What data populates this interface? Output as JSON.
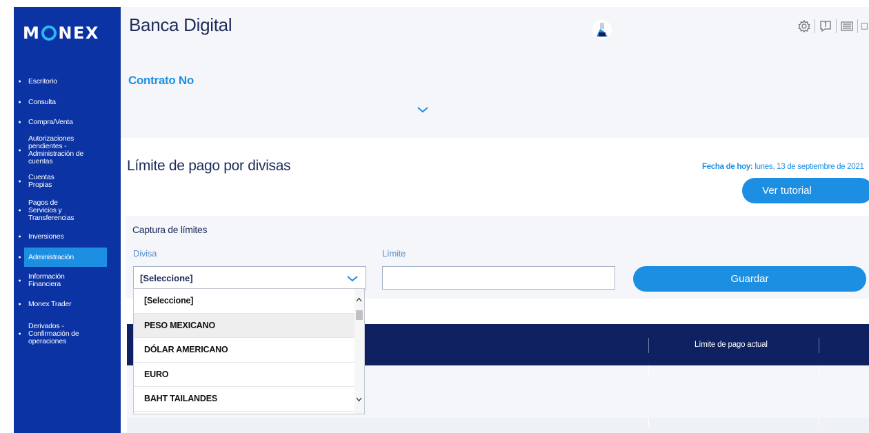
{
  "sidebar": {
    "logo_left": "M",
    "logo_right": "NEX",
    "items": [
      {
        "label": "Escritorio"
      },
      {
        "label": "Consulta"
      },
      {
        "label": "Compra/Venta"
      },
      {
        "label": "Autorizaciones pendientes - Administración de cuentas"
      },
      {
        "label": "Cuentas Propias"
      },
      {
        "label": "Pagos de Servicios y Transferencias"
      },
      {
        "label": "Inversiones"
      },
      {
        "label": "Administración",
        "active": true
      },
      {
        "label": "Información Financiera"
      },
      {
        "label": "Monex Trader"
      },
      {
        "label": "Derivados - Confirmación de operaciones"
      }
    ]
  },
  "header": {
    "title": "Banca Digital",
    "icons": [
      "settings-icon",
      "info-icon",
      "news-icon",
      "exit-icon"
    ]
  },
  "contract": {
    "title": "Contrato No"
  },
  "page": {
    "title": "Límite de pago por divisas",
    "today_label": "Fecha de hoy:",
    "today_value": " lunes, 13 de septiembre de 2021",
    "tutorial_button": "Ver tutorial"
  },
  "capture": {
    "title": "Captura de límites",
    "currency_label": "Divisa",
    "currency_value": "[Seleccione]",
    "limit_label": "Límite",
    "limit_value": "",
    "save_button": "Guardar"
  },
  "dropdown": {
    "options": [
      "[Seleccione]",
      "PESO MEXICANO",
      "DÓLAR AMERICANO",
      "EURO",
      "BAHT TAILANDES"
    ],
    "highlighted": "PESO MEXICANO"
  },
  "table": {
    "columns": [
      "Límite de pago actual"
    ]
  },
  "colors": {
    "sidebar": "#0b33a3",
    "accent": "#1d8fe2",
    "navy": "#0f2161",
    "title": "#1d2c5b",
    "panel": "#f4f6f9"
  }
}
